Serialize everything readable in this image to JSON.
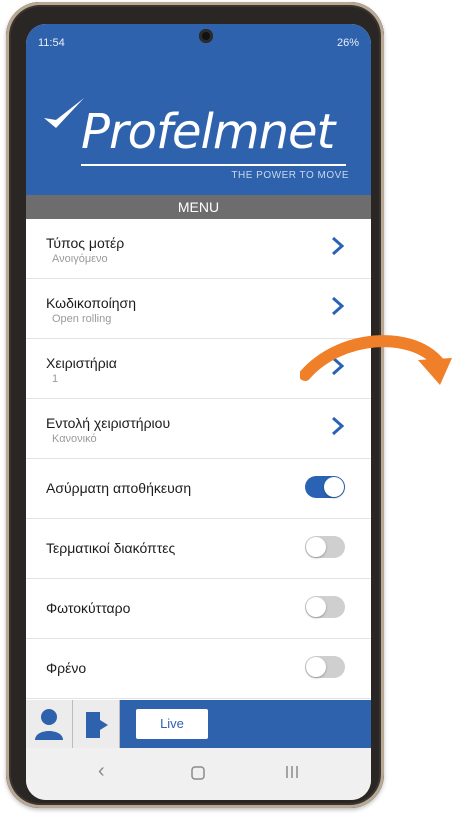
{
  "status_bar": {
    "time": "11:54",
    "indicators": "26%"
  },
  "brand": {
    "name": "Profelmnet",
    "tagline": "THE POWER TO MOVE"
  },
  "menu": {
    "title": "MENU",
    "items": [
      {
        "label": "Τύπος μοτέρ",
        "value": "Ανοιγόμενο",
        "type": "nav"
      },
      {
        "label": "Κωδικοποίηση",
        "value": "Open rolling",
        "type": "nav"
      },
      {
        "label": "Χειριστήρια",
        "value": "1",
        "type": "nav"
      },
      {
        "label": "Εντολή χειριστήριου",
        "value": "Κανονικό",
        "type": "nav"
      },
      {
        "label": "Ασύρματη αποθήκευση",
        "type": "toggle",
        "on": true
      },
      {
        "label": "Τερματικοί διακόπτες",
        "type": "toggle",
        "on": false
      },
      {
        "label": "Φωτοκύτταρο",
        "type": "toggle",
        "on": false
      },
      {
        "label": "Φρένο",
        "type": "toggle",
        "on": false
      }
    ]
  },
  "bottom_bar": {
    "live_label": "Live"
  },
  "colors": {
    "brand_blue": "#2f62ad",
    "toggle_on": "#2b63b4",
    "annotation_arrow": "#f07f2a"
  },
  "icons": [
    "user-icon",
    "logout-icon",
    "chevron-right-icon",
    "back-icon",
    "home-icon",
    "recents-icon",
    "curved-arrow-icon"
  ]
}
